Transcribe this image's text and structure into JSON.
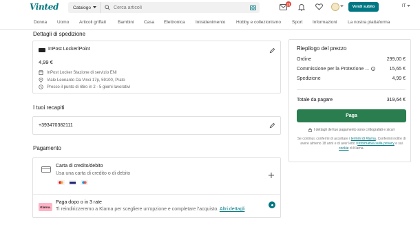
{
  "header": {
    "logo": "Vinted",
    "catalog_label": "Catalogo",
    "search_placeholder": "Cerca articoli",
    "notifications_count": "21",
    "sell_button": "Vendi subito",
    "language": "IT"
  },
  "nav": {
    "items": [
      "Donna",
      "Uomo",
      "Articoli griffati",
      "Bambini",
      "Casa",
      "Elettronica",
      "Intrattenimento",
      "Hobby e collezionismo",
      "Sport",
      "Informazioni",
      "La nostra piattaforma"
    ]
  },
  "shipping": {
    "title": "Dettagli di spedizione",
    "carrier": "InPost Locker/Point",
    "price": "4,99 €",
    "location_name": "InPost Locker Stazione di servizio ENI",
    "address": "Viale Leonardo Da Vinci 17p, 59100, Prato",
    "delivery_time": "Presso il punto di ritiro in 2 - 5 giorni lavorativi"
  },
  "contacts": {
    "title": "I tuoi recapiti",
    "phone": "+393470382111"
  },
  "payment": {
    "title": "Pagamento",
    "card_title": "Carta di credito/debito",
    "card_subtitle": "Usa una carta di credito o di debito",
    "card_brands": [
      "mastercard-icon",
      "visa-icon",
      "maestro-icon"
    ],
    "klarna_logo": "Klarna.",
    "klarna_title": "Paga dopo o in 3 rate",
    "klarna_subtitle": "Ti reindirizzeremo a Klarna per scegliere un'opzione e completare l'acquisto.",
    "klarna_link": "Altri dettagli"
  },
  "summary": {
    "title": "Riepilogo del prezzo",
    "rows": [
      {
        "label": "Ordine",
        "value": "299,00 €"
      },
      {
        "label": "Commissione per la Protezione ...",
        "value": "15,65 €"
      },
      {
        "label": "Spedizione",
        "value": "4,99 €"
      }
    ],
    "total_label": "Totale da pagare",
    "total_value": "319,64 €",
    "pay_button": "Paga",
    "secure_note": "I dettagli del tuo pagamento sono crittografati e sicuri",
    "legal_1": "Se continui, confermi di accettare i",
    "legal_link_1": "termini di Klarna",
    "legal_2": ". Confermi inoltre di avere almeno 18 anni e di aver letto l'",
    "legal_link_2": "Informativa sulla privacy",
    "legal_3": " e sui",
    "legal_link_3": "cookie",
    "legal_4": " di Klarna."
  },
  "colors": {
    "brand": "#007782",
    "pay_button": "#2a7d4f",
    "klarna_pink": "#ffb3c7"
  }
}
